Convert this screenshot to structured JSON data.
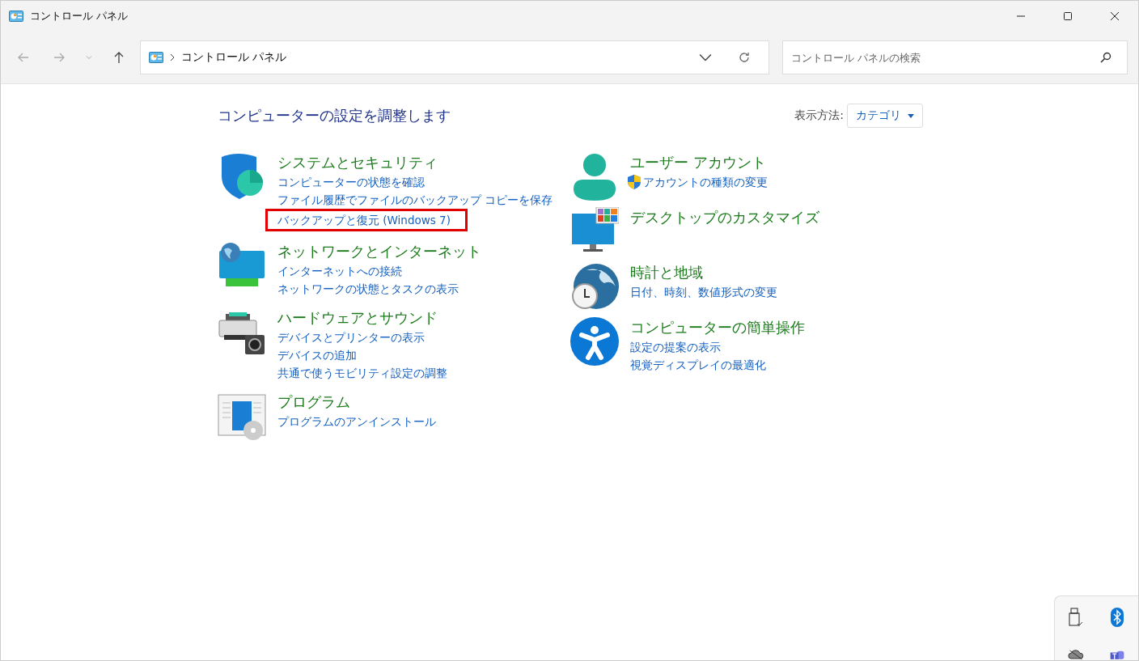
{
  "window": {
    "title": "コントロール パネル"
  },
  "address_bar": {
    "path": "コントロール パネル"
  },
  "search": {
    "placeholder": "コントロール パネルの検索"
  },
  "heading": "コンピューターの設定を調整します",
  "view_by": {
    "label": "表示方法:",
    "value": "カテゴリ"
  },
  "columns": [
    {
      "categories": [
        {
          "kind": "security",
          "title": "システムとセキュリティ",
          "links": [
            {
              "text": "コンピューターの状態を確認",
              "highlighted": false,
              "shield": false
            },
            {
              "text": "ファイル履歴でファイルのバックアップ コピーを保存",
              "highlighted": false,
              "shield": false
            },
            {
              "text": "バックアップと復元 (Windows 7)",
              "highlighted": true,
              "shield": false
            }
          ]
        },
        {
          "kind": "network",
          "title": "ネットワークとインターネット",
          "links": [
            {
              "text": "インターネットへの接続",
              "highlighted": false,
              "shield": false
            },
            {
              "text": "ネットワークの状態とタスクの表示",
              "highlighted": false,
              "shield": false
            }
          ]
        },
        {
          "kind": "hardware",
          "title": "ハードウェアとサウンド",
          "links": [
            {
              "text": "デバイスとプリンターの表示",
              "highlighted": false,
              "shield": false
            },
            {
              "text": "デバイスの追加",
              "highlighted": false,
              "shield": false
            },
            {
              "text": "共通で使うモビリティ設定の調整",
              "highlighted": false,
              "shield": false
            }
          ]
        },
        {
          "kind": "programs",
          "title": "プログラム",
          "links": [
            {
              "text": "プログラムのアンインストール",
              "highlighted": false,
              "shield": false
            }
          ]
        }
      ]
    },
    {
      "categories": [
        {
          "kind": "user",
          "title": "ユーザー アカウント",
          "links": [
            {
              "text": "アカウントの種類の変更",
              "highlighted": false,
              "shield": true
            }
          ]
        },
        {
          "kind": "desktop",
          "title": "デスクトップのカスタマイズ"
        },
        {
          "kind": "clock",
          "title": "時計と地域",
          "links": [
            {
              "text": "日付、時刻、数値形式の変更",
              "highlighted": false,
              "shield": false
            }
          ]
        },
        {
          "kind": "access",
          "title": "コンピューターの簡単操作",
          "links": [
            {
              "text": "設定の提案の表示",
              "highlighted": false,
              "shield": false
            },
            {
              "text": "視覚ディスプレイの最適化",
              "highlighted": false,
              "shield": false
            }
          ]
        }
      ]
    }
  ]
}
